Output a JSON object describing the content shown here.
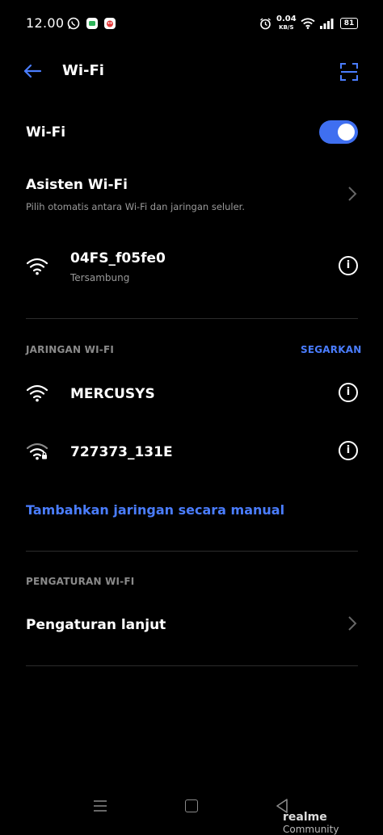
{
  "status_bar": {
    "time": "12.00",
    "speed_value": "0.04",
    "speed_unit": "KB/S",
    "battery": "81",
    "icons": [
      "whatsapp-icon",
      "message-app-icon",
      "notification-app-icon",
      "alarm-icon",
      "wifi-icon",
      "signal-icon",
      "battery-icon"
    ]
  },
  "header": {
    "title": "Wi-Fi",
    "back_icon": "back-arrow-icon",
    "scan_icon": "qr-scan-icon"
  },
  "wifi_toggle": {
    "label": "Wi-Fi",
    "state": "on",
    "accent_color": "#3f6ff0"
  },
  "assistant": {
    "title": "Asisten Wi-Fi",
    "subtitle": "Pilih otomatis antara Wi-Fi dan jaringan seluler."
  },
  "connected": {
    "ssid": "04FS_f05fe0",
    "status": "Tersambung"
  },
  "networks_section": {
    "header": "JARINGAN WI-FI",
    "refresh_label": "SEGARKAN",
    "networks": [
      {
        "ssid": "MERCUSYS",
        "secured": false
      },
      {
        "ssid": "727373_131E",
        "secured": true
      }
    ],
    "add_manual_label": "Tambahkan jaringan secara manual"
  },
  "settings_section": {
    "header": "PENGATURAN WI-FI",
    "advanced_label": "Pengaturan lanjut"
  },
  "watermark": {
    "brand": "realme",
    "suffix": "Community"
  }
}
